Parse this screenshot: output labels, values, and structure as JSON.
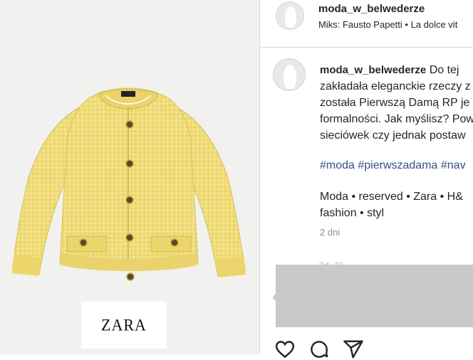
{
  "post": {
    "brand_logo": "ZARA"
  },
  "header": {
    "username": "moda_w_belwederze",
    "music": "Miks: Fausto Papetti • La dolce vit"
  },
  "caption": {
    "username": "moda_w_belwederze",
    "first_line": "Do tej",
    "lines": [
      "zakładała eleganckie rzeczy z",
      "została Pierwszą Damą RP je",
      "formalności. Jak myślisz? Pow",
      "sieciówek czy jednak postaw"
    ],
    "hashtags": "#moda #pierwszadama #nav",
    "tags_line1": "Moda • reserved • Zara • H&",
    "tags_line2": "fashion • styl",
    "time": "2 dni"
  },
  "faint_text": "Zdj. Pl...",
  "icons": {
    "like": "heart-icon",
    "comment": "comment-icon",
    "share": "share-icon"
  },
  "colors": {
    "cardigan": "#f1de7a",
    "link": "#385185",
    "muted": "#8e8e8e"
  }
}
